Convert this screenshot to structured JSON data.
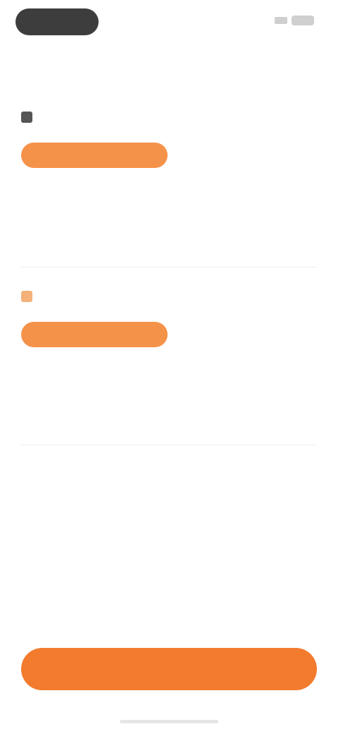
{
  "status_bar": {
    "time": "",
    "icons": [
      "signal-icon",
      "battery-icon"
    ]
  },
  "header": {
    "title": ""
  },
  "cards": [
    {
      "icon": "card-icon",
      "title": "",
      "description": "",
      "button_label": "",
      "stats": [
        {
          "label": "",
          "value": ""
        },
        {
          "label": "",
          "value": ""
        }
      ]
    },
    {
      "icon": "card-icon",
      "title": "",
      "description": "",
      "button_label": "",
      "stats": [
        {
          "label": "",
          "value": ""
        },
        {
          "label": "",
          "value": ""
        }
      ]
    }
  ],
  "footer": {
    "primary_button_label": ""
  },
  "colors": {
    "accent": "#f27b2e",
    "accent_light": "#f5924a",
    "text_muted": "#9a9a9a"
  }
}
